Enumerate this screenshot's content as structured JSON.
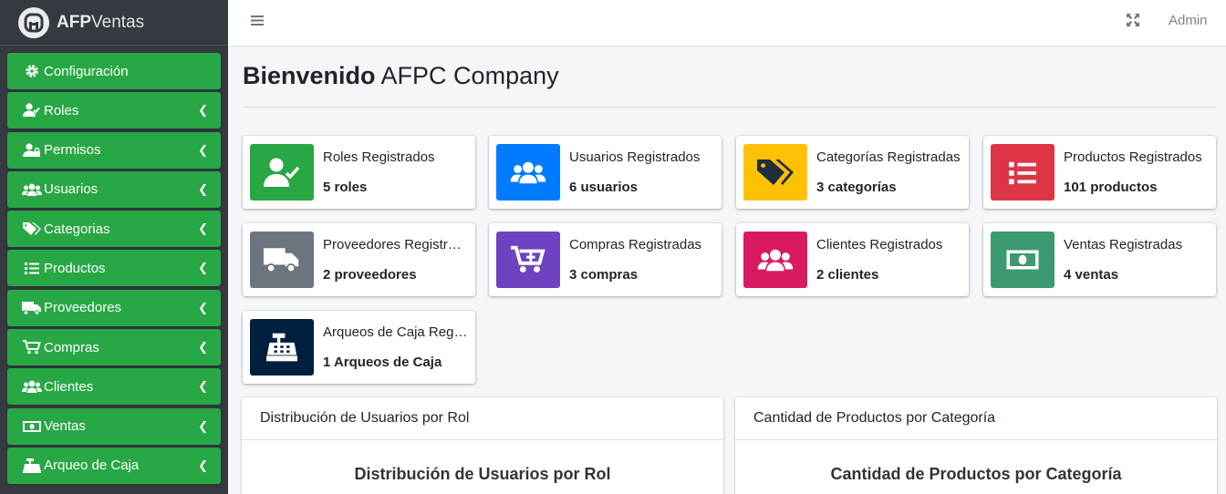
{
  "brand": {
    "name_bold": "AFP",
    "name_rest": "Ventas"
  },
  "topbar": {
    "user": "Admin"
  },
  "sidebar": {
    "items": [
      {
        "label": "Configuración",
        "icon": "gear-icon",
        "has_chevron": false
      },
      {
        "label": "Roles",
        "icon": "user-check-icon",
        "has_chevron": true
      },
      {
        "label": "Permisos",
        "icon": "user-lock-icon",
        "has_chevron": true
      },
      {
        "label": "Usuarios",
        "icon": "users-icon",
        "has_chevron": true
      },
      {
        "label": "Categorias",
        "icon": "tags-icon",
        "has_chevron": true
      },
      {
        "label": "Productos",
        "icon": "list-icon",
        "has_chevron": true
      },
      {
        "label": "Proveedores",
        "icon": "truck-icon",
        "has_chevron": true
      },
      {
        "label": "Compras",
        "icon": "cart-icon",
        "has_chevron": true
      },
      {
        "label": "Clientes",
        "icon": "users-icon",
        "has_chevron": true
      },
      {
        "label": "Ventas",
        "icon": "money-icon",
        "has_chevron": true
      },
      {
        "label": "Arqueo de Caja",
        "icon": "cash-register-icon",
        "has_chevron": true
      }
    ]
  },
  "main": {
    "title_bold": "Bienvenido",
    "title_rest": "AFPC Company",
    "boxes": [
      {
        "text": "Roles Registrados",
        "number": "5 roles",
        "color": "#28a745",
        "icon": "user-check-icon"
      },
      {
        "text": "Usuarios Registrados",
        "number": "6 usuarios",
        "color": "#007bff",
        "icon": "users-icon"
      },
      {
        "text": "Categorías Registradas",
        "number": "3 categorías",
        "color": "#ffc107",
        "icon": "tags-icon"
      },
      {
        "text": "Productos Registrados",
        "number": "101 productos",
        "color": "#dc3545",
        "icon": "list-icon"
      },
      {
        "text": "Proveedores Registrados",
        "number": "2 proveedores",
        "color": "#6c757d",
        "icon": "truck-icon"
      },
      {
        "text": "Compras Registradas",
        "number": "3 compras",
        "color": "#6f42c1",
        "icon": "cart-plus-icon"
      },
      {
        "text": "Clientes Registrados",
        "number": "2 clientes",
        "color": "#d81b60",
        "icon": "users-icon"
      },
      {
        "text": "Ventas Registradas",
        "number": "4 ventas",
        "color": "#3d9970",
        "icon": "money-icon"
      },
      {
        "text": "Arqueos de Caja Registrados",
        "number": "1 Arqueos de Caja",
        "color": "#001f3f",
        "icon": "cash-register-icon"
      }
    ],
    "cards": [
      {
        "header": "Distribución de Usuarios por Rol",
        "chart_title": "Distribución de Usuarios por Rol"
      },
      {
        "header": "Cantidad de Productos por Categoría",
        "chart_title": "Cantidad de Productos por Categoría"
      }
    ]
  }
}
